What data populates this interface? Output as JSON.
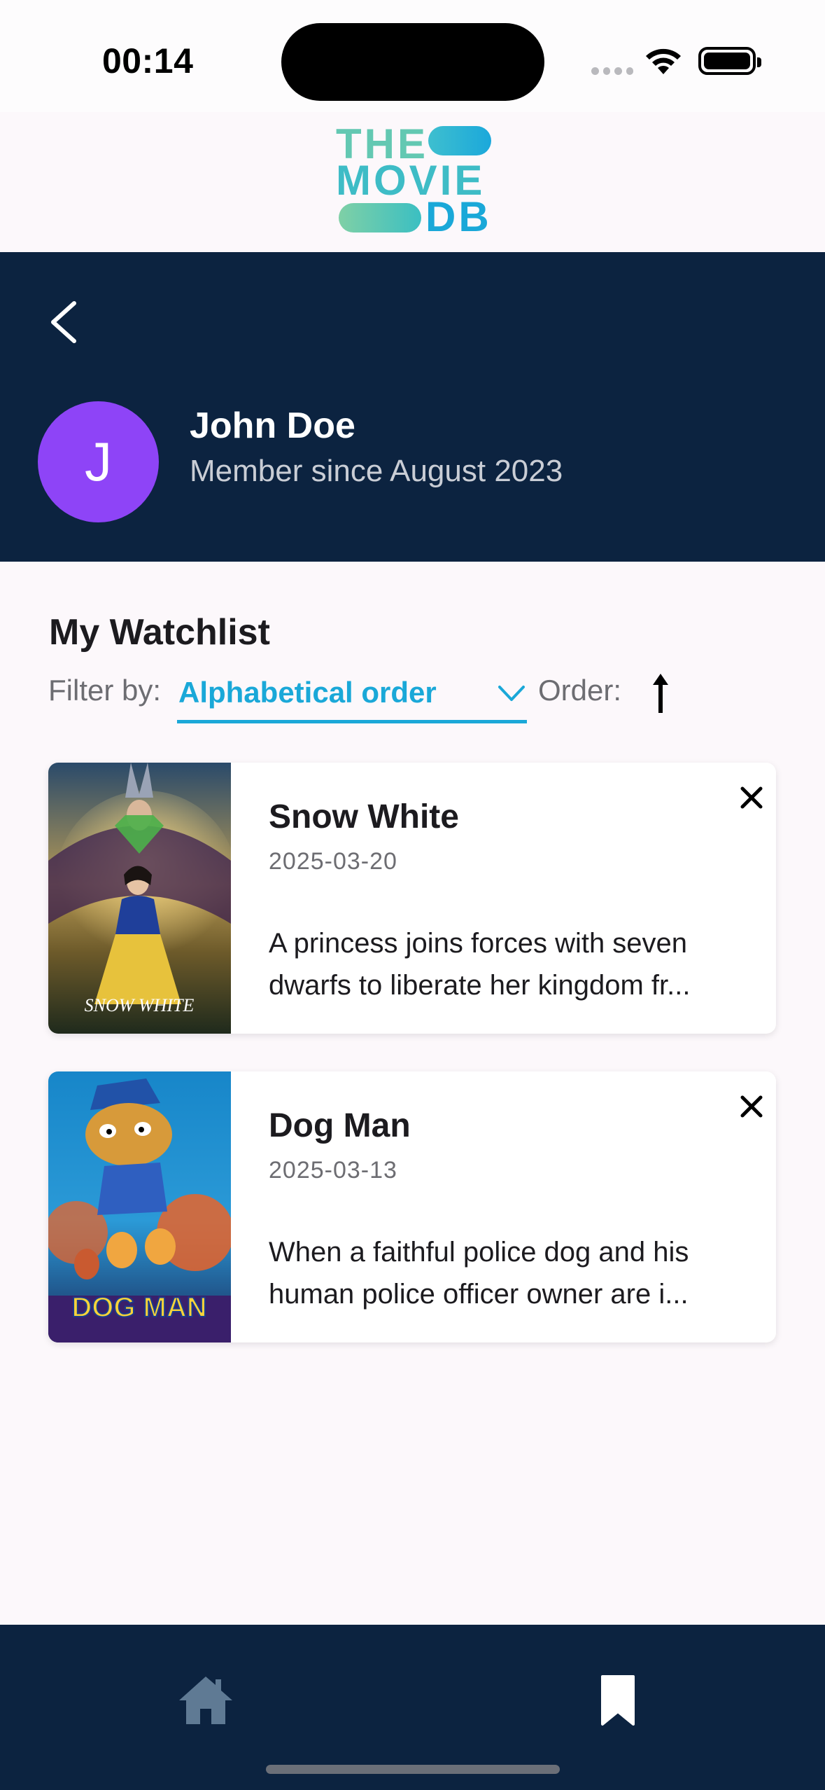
{
  "status_bar": {
    "time": "00:14"
  },
  "brand": {
    "logo_line1": "THE",
    "logo_line2": "MOVIE",
    "logo_line3": "DB"
  },
  "profile": {
    "avatar_initial": "J",
    "name": "John Doe",
    "member_since": "Member since August 2023",
    "avatar_color": "#8e44f7"
  },
  "watchlist": {
    "title": "My Watchlist",
    "filter_label": "Filter by:",
    "filter_value": "Alphabetical order",
    "order_label": "Order:",
    "order_direction": "ascending",
    "items": [
      {
        "title": "Snow White",
        "release_date": "2025-03-20",
        "overview_line1": "A princess joins forces with seven",
        "overview_line2": "dwarfs to liberate her kingdom fr...",
        "poster_text": "SNOW WHITE"
      },
      {
        "title": "Dog Man",
        "release_date": "2025-03-13",
        "overview_line1": "When a faithful police dog and his",
        "overview_line2": "human police officer owner are i...",
        "poster_text": "DOG MAN"
      }
    ]
  },
  "bottom_nav": {
    "items": [
      {
        "icon": "home-icon",
        "active": false
      },
      {
        "icon": "bookmark-icon",
        "active": true
      }
    ]
  },
  "colors": {
    "header_bg": "#0c2340",
    "accent": "#1aa8d8",
    "page_bg": "#fcf8fb"
  }
}
